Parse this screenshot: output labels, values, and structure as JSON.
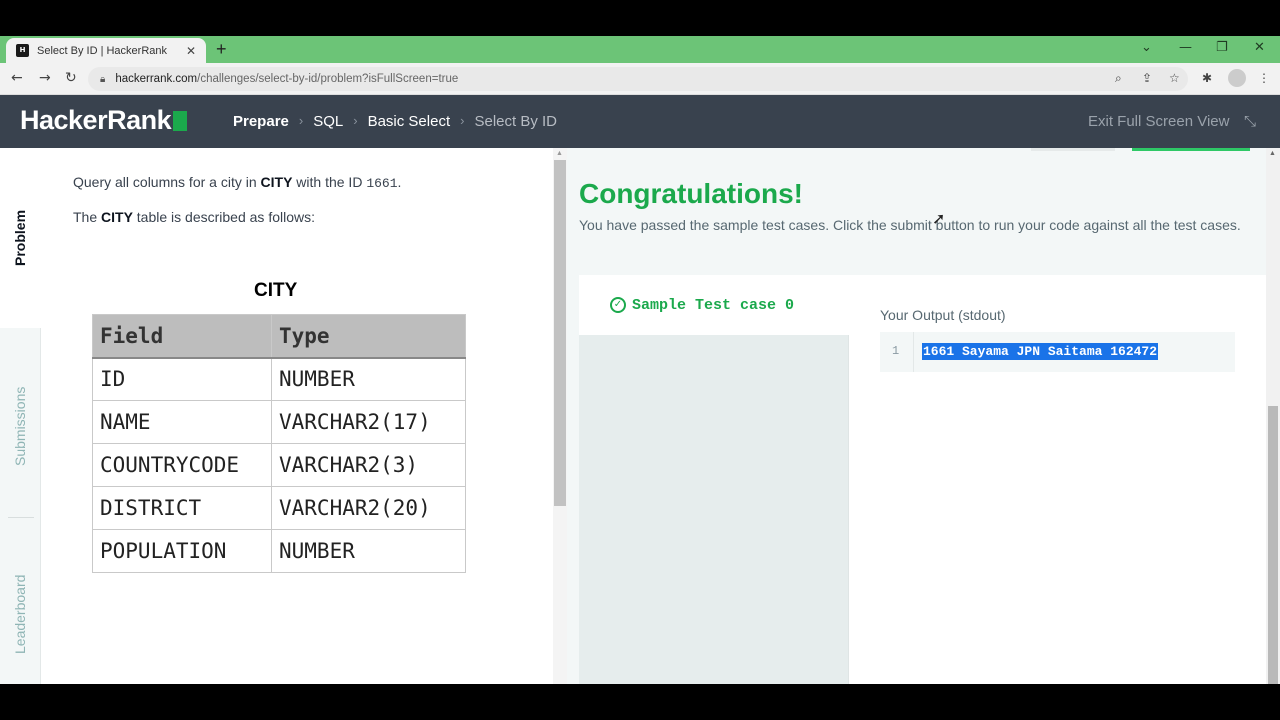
{
  "browser": {
    "tab_title": "Select By ID | HackerRank",
    "favicon_text": "H",
    "url_host": "hackerrank.com",
    "url_path": "/challenges/select-by-id/problem?isFullScreen=true"
  },
  "header": {
    "logo": "HackerRank",
    "breadcrumbs": [
      "Prepare",
      "SQL",
      "Basic Select",
      "Select By ID"
    ],
    "exit_fullscreen": "Exit Full Screen View"
  },
  "sidebar": {
    "tabs": [
      "Problem",
      "Submissions",
      "Leaderboard"
    ]
  },
  "problem": {
    "line1_pre": "Query all columns for a city in ",
    "line1_bold": "CITY",
    "line1_mid": " with the ID ",
    "line1_id": "1661",
    "line1_end": ".",
    "line2_pre": "The ",
    "line2_bold": "CITY",
    "line2_post": " table is described as follows:",
    "table_title": "CITY",
    "table_headers": [
      "Field",
      "Type"
    ],
    "table_rows": [
      [
        "ID",
        "NUMBER"
      ],
      [
        "NAME",
        "VARCHAR2(17)"
      ],
      [
        "COUNTRYCODE",
        "VARCHAR2(3)"
      ],
      [
        "DISTRICT",
        "VARCHAR2(20)"
      ],
      [
        "POPULATION",
        "NUMBER"
      ]
    ]
  },
  "result": {
    "title": "Congratulations!",
    "message": "You have passed the sample test cases. Click the submit button to run your code against all the test cases.",
    "test_case": "Sample Test case 0",
    "output_label": "Your Output (stdout)",
    "line_number": "1",
    "output_value": "1661 Sayama JPN Saitama 162472"
  },
  "colors": {
    "accent_green": "#1ba94c",
    "header_bg": "#39424e",
    "selection_blue": "#1a73e8"
  }
}
